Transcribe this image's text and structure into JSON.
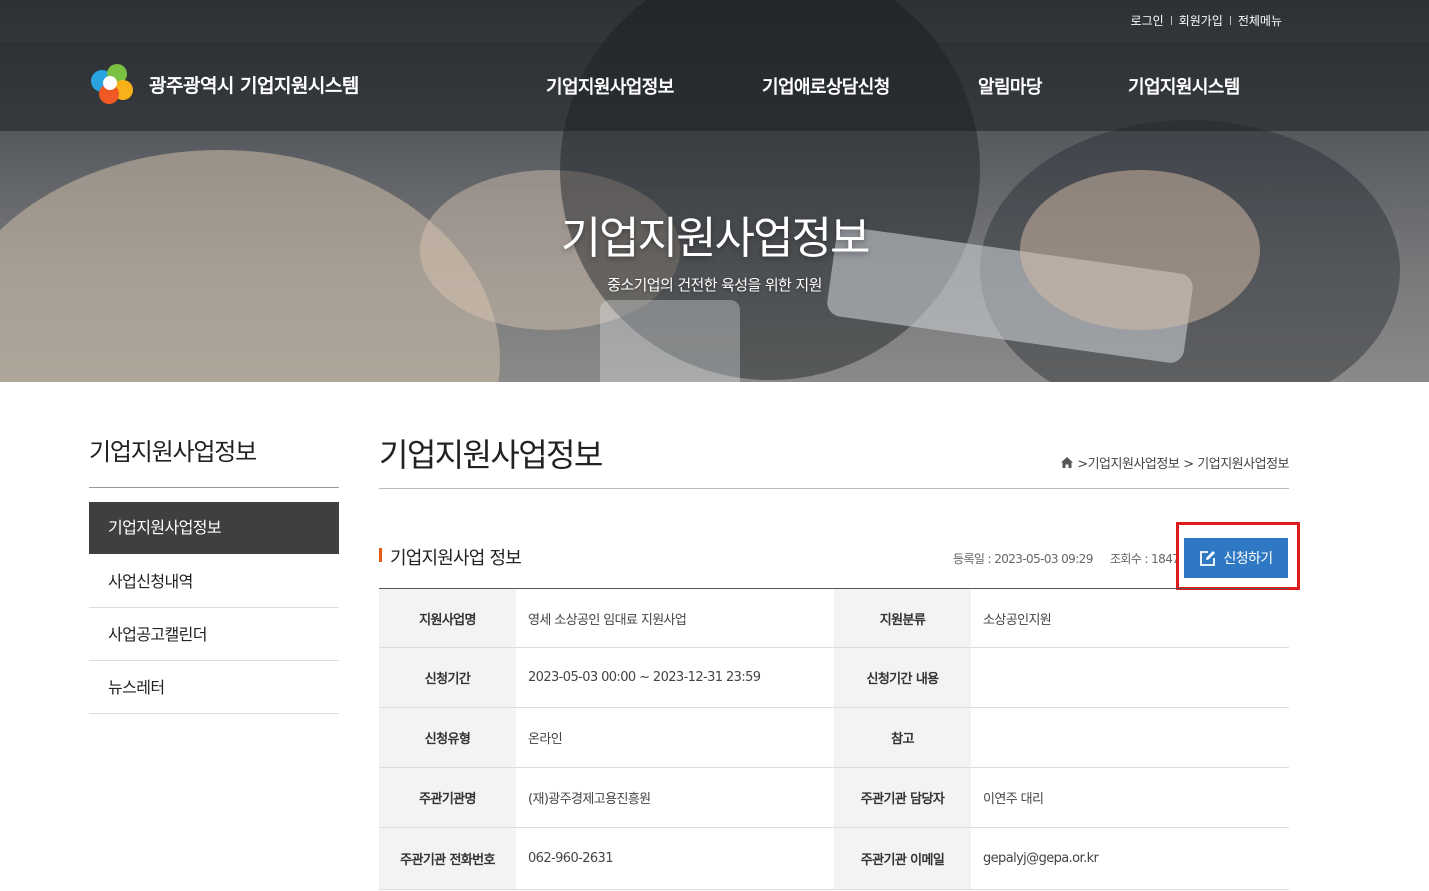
{
  "utility_links": [
    "로그인",
    "회원가입",
    "전체메뉴"
  ],
  "site_name": "광주광역시 기업지원시스템",
  "main_menu": [
    "기업지원사업정보",
    "기업애로상담신청",
    "알림마당",
    "기업지원시스템"
  ],
  "hero": {
    "title": "기업지원사업정보",
    "subtitle": "중소기업의 건전한 육성을 위한 지원"
  },
  "sidebar": {
    "title": "기업지원사업정보",
    "items": [
      {
        "label": "기업지원사업정보",
        "active": true
      },
      {
        "label": "사업신청내역",
        "active": false
      },
      {
        "label": "사업공고캘린더",
        "active": false
      },
      {
        "label": "뉴스레터",
        "active": false
      }
    ]
  },
  "page_title": "기업지원사업정보",
  "breadcrumb": [
    ">기업지원사업정보",
    "> 기업지원사업정보"
  ],
  "section": {
    "title": "기업지원사업 정보",
    "registered": "등록일 : 2023-05-03 09:29",
    "views": "조회수 : 1847",
    "apply_label": "신청하기"
  },
  "info_rows": [
    {
      "label1": "지원사업명",
      "value1": "영세 소상공인 임대료 지원사업",
      "label2": "지원분류",
      "value2": "소상공인지원"
    },
    {
      "label1": "신청기간",
      "value1": "2023-05-03 00:00 ~ 2023-12-31 23:59",
      "label2": "신청기간 내용",
      "value2": ""
    },
    {
      "label1": "신청유형",
      "value1": "온라인",
      "label2": "참고",
      "value2": ""
    },
    {
      "label1": "주관기관명",
      "value1": "(재)광주경제고용진흥원",
      "label2": "주관기관 담당자",
      "value2": "이연주 대리"
    },
    {
      "label1": "주관기관 전화번호",
      "value1": "062-960-2631",
      "label2": "주관기관 이메일",
      "value2": "gepalyj@gepa.or.kr"
    }
  ],
  "colors": {
    "accent_blue": "#2f78c3",
    "section_bar": "#e25a1c",
    "highlight_frame": "#e0191b",
    "sidebar_active": "#3f3f3f"
  }
}
